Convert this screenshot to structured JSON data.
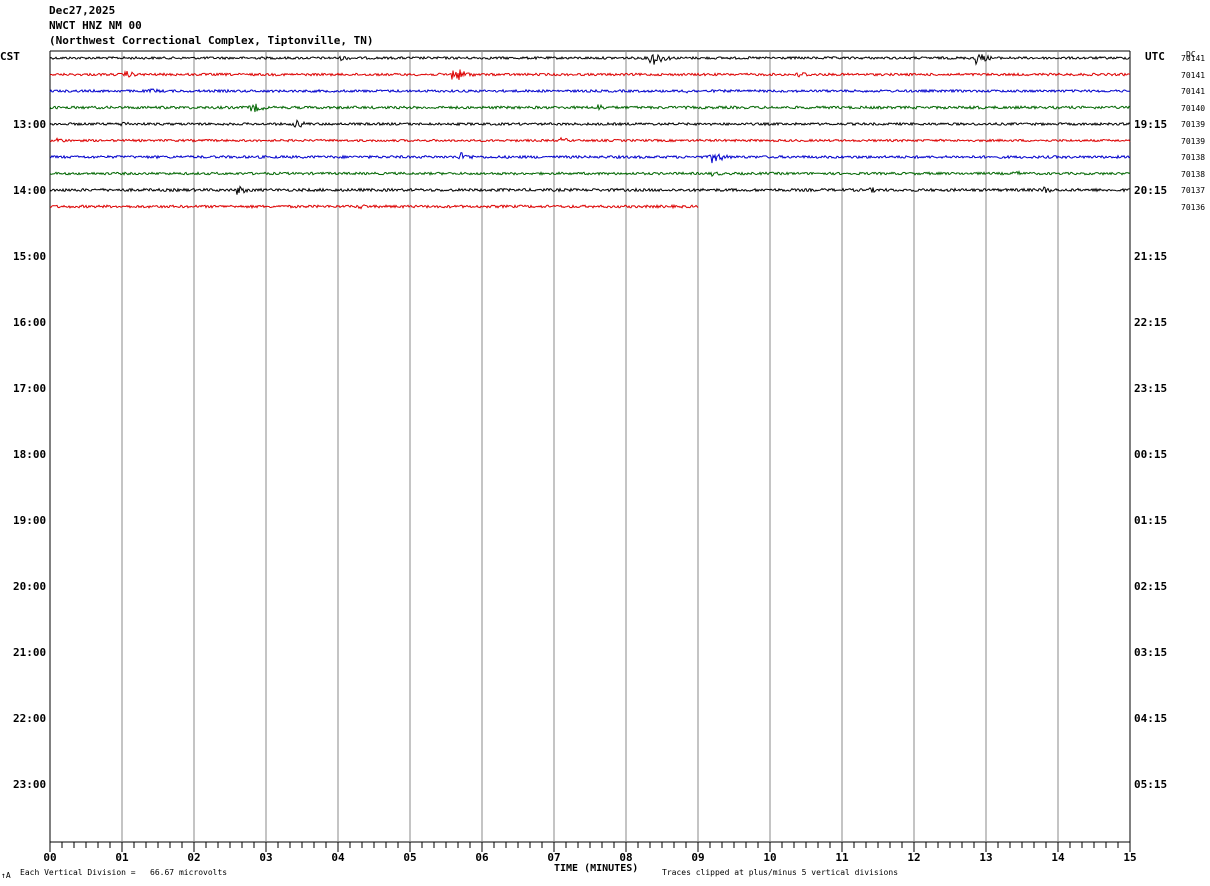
{
  "header": {
    "date": "Dec27,2025",
    "station": "NWCT HNZ NM 00",
    "location": "(Northwest Correctional Complex, Tiptonville, TN)"
  },
  "axis": {
    "left_label": "CST",
    "right_label": "UTC",
    "dc_label": "DC",
    "x_title": "TIME (MINUTES)"
  },
  "footer": {
    "left_mark": "↑A",
    "scale_note": "Each Vertical Division =   66.67 microvolts",
    "clip_note": "Traces clipped at plus/minus 5 vertical divisions"
  },
  "chart_data": {
    "type": "line",
    "x_label": "TIME (MINUTES)",
    "x_range": [
      0,
      15
    ],
    "x_ticks": [
      "00",
      "01",
      "02",
      "03",
      "04",
      "05",
      "06",
      "07",
      "08",
      "09",
      "10",
      "11",
      "12",
      "13",
      "14",
      "15"
    ],
    "cst_hours": [
      "13:00",
      "14:00",
      "15:00",
      "16:00",
      "17:00",
      "18:00",
      "19:00",
      "20:00",
      "21:00",
      "22:00",
      "23:00"
    ],
    "utc_hours": [
      "19:15",
      "20:15",
      "21:15",
      "22:15",
      "23:15",
      "00:15",
      "01:15",
      "02:15",
      "03:15",
      "04:15",
      "05:15"
    ],
    "trace_colors": [
      "#000000",
      "#dd0000",
      "#0000cc",
      "#006600"
    ],
    "traces": [
      {
        "row": 0,
        "color": "#000000",
        "dc": "70141",
        "end_minute": 15,
        "noise": 1.2,
        "events": [
          {
            "t": 4.05,
            "amp": 3
          },
          {
            "t": 8.35,
            "amp": 9
          },
          {
            "t": 12.85,
            "amp": 7
          }
        ]
      },
      {
        "row": 1,
        "color": "#dd0000",
        "dc": "70141",
        "end_minute": 15,
        "noise": 1.2,
        "events": [
          {
            "t": 1.05,
            "amp": 4
          },
          {
            "t": 5.6,
            "amp": 9
          },
          {
            "t": 10.4,
            "amp": 4
          }
        ]
      },
      {
        "row": 2,
        "color": "#0000cc",
        "dc": "70141",
        "end_minute": 15,
        "noise": 1.2,
        "events": [
          {
            "t": 1.4,
            "amp": 3
          },
          {
            "t": 8.8,
            "amp": 3
          }
        ]
      },
      {
        "row": 3,
        "color": "#006600",
        "dc": "70140",
        "end_minute": 15,
        "noise": 1.3,
        "events": [
          {
            "t": 2.8,
            "amp": 6
          },
          {
            "t": 7.6,
            "amp": 4
          },
          {
            "t": 12.8,
            "amp": 3
          }
        ]
      },
      {
        "row": 4,
        "color": "#000000",
        "dc": "70139",
        "end_minute": 15,
        "noise": 1.2,
        "events": [
          {
            "t": 1.0,
            "amp": 3
          },
          {
            "t": 3.4,
            "amp": 5
          }
        ]
      },
      {
        "row": 5,
        "color": "#dd0000",
        "dc": "70139",
        "end_minute": 15,
        "noise": 1.1,
        "events": [
          {
            "t": 0.1,
            "amp": 3
          },
          {
            "t": 7.1,
            "amp": 3
          }
        ]
      },
      {
        "row": 6,
        "color": "#0000cc",
        "dc": "70138",
        "end_minute": 15,
        "noise": 1.3,
        "events": [
          {
            "t": 5.7,
            "amp": 5
          },
          {
            "t": 9.2,
            "amp": 7
          }
        ]
      },
      {
        "row": 7,
        "color": "#006600",
        "dc": "70138",
        "end_minute": 15,
        "noise": 1.2,
        "events": [
          {
            "t": 9.2,
            "amp": 3
          },
          {
            "t": 13.4,
            "amp": 3
          }
        ]
      },
      {
        "row": 8,
        "color": "#000000",
        "dc": "70137",
        "end_minute": 15,
        "noise": 1.4,
        "events": [
          {
            "t": 2.6,
            "amp": 5
          },
          {
            "t": 11.4,
            "amp": 3
          },
          {
            "t": 13.8,
            "amp": 4
          }
        ]
      },
      {
        "row": 9,
        "color": "#dd0000",
        "dc": "70136",
        "end_minute": 9,
        "noise": 1.3,
        "events": [
          {
            "t": 4.3,
            "amp": 3
          }
        ]
      }
    ]
  }
}
